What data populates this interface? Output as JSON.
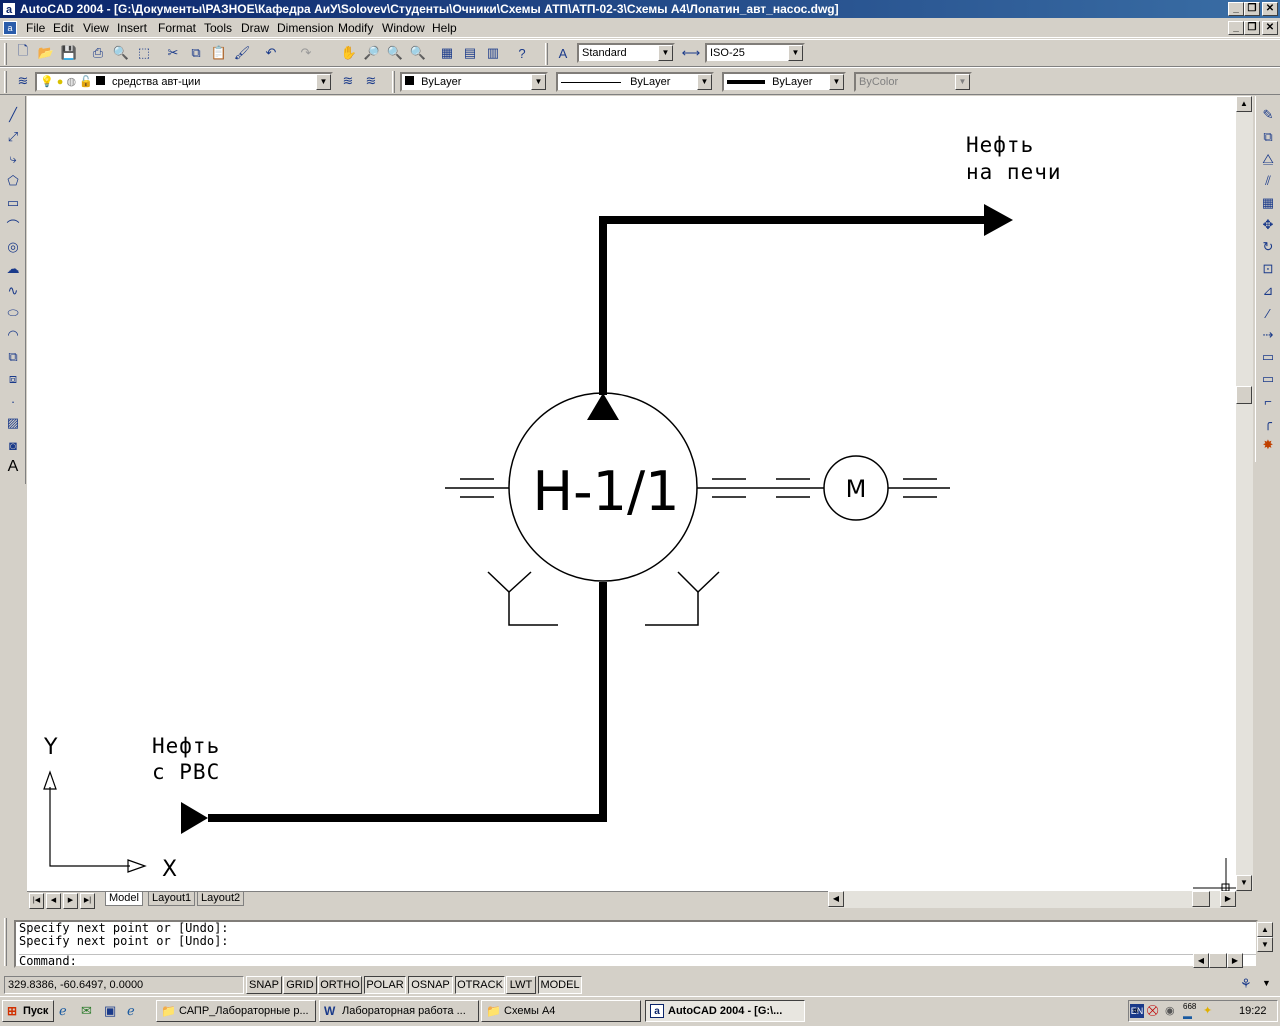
{
  "window": {
    "title": "AutoCAD 2004 - [G:\\Документы\\РАЗНОЕ\\Кафедра АиУ\\Solovev\\Студенты\\Очники\\Схемы АТП\\АТП-02-3\\Схемы А4\\Лопатин_авт_насос.dwg]",
    "app_icon": "a"
  },
  "menu": [
    "File",
    "Edit",
    "View",
    "Insert",
    "Format",
    "Tools",
    "Draw",
    "Dimension",
    "Modify",
    "Window",
    "Help"
  ],
  "toolbar": {
    "text_style": "Standard",
    "dim_style": "ISO-25",
    "layer": "средства авт-ции",
    "color": "ByLayer",
    "linetype": "ByLayer",
    "lineweight": "ByLayer",
    "plotstyle": "ByColor"
  },
  "drawing": {
    "label_out_line1": "Нефть",
    "label_out_line2": "на печи",
    "label_in_line1": "Нефть",
    "label_in_line2": "с РВС",
    "pump_tag": "Н-1/1",
    "motor_tag": "М",
    "ucs_x": "X",
    "ucs_y": "Y"
  },
  "tabs": [
    "Model",
    "Layout1",
    "Layout2"
  ],
  "command": {
    "line1": "Specify next point or [Undo]:",
    "line2": "Specify next point or [Undo]:",
    "prompt": "Command:"
  },
  "status": {
    "coords": "329.8386, -60.6497, 0.0000",
    "toggles": [
      "SNAP",
      "GRID",
      "ORTHO",
      "POLAR",
      "OSNAP",
      "OTRACK",
      "LWT",
      "MODEL"
    ]
  },
  "taskbar": {
    "start": "Пуск",
    "tasks": [
      "САПР_Лабораторные р...",
      "Лабораторная работа ...",
      "Схемы А4",
      "AutoCAD 2004 - [G:\\..."
    ],
    "lang": "EN",
    "tray_num": "668",
    "clock": "19:22"
  }
}
